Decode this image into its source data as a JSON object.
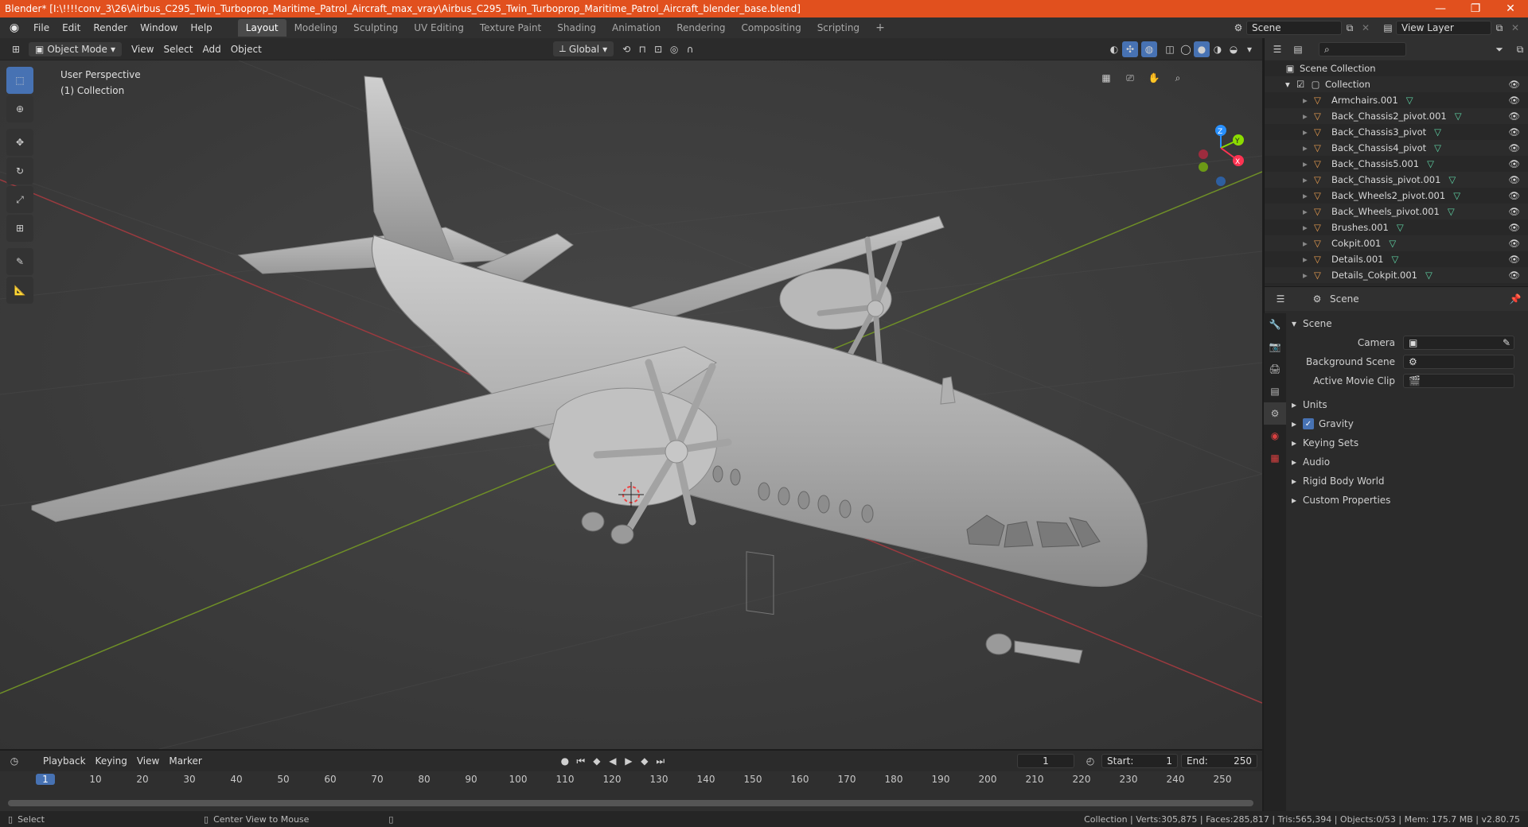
{
  "titlebar": {
    "title": "Blender* [I:\\!!!!conv_3\\26\\Airbus_C295_Twin_Turboprop_Maritime_Patrol_Aircraft_max_vray\\Airbus_C295_Twin_Turboprop_Maritime_Patrol_Aircraft_blender_base.blend]",
    "minimize": "—",
    "maximize": "❐",
    "close": "✕"
  },
  "menubar": {
    "menus": [
      "File",
      "Edit",
      "Render",
      "Window",
      "Help"
    ],
    "workspaces": [
      "Layout",
      "Modeling",
      "Sculpting",
      "UV Editing",
      "Texture Paint",
      "Shading",
      "Animation",
      "Rendering",
      "Compositing",
      "Scripting"
    ],
    "active_workspace": "Layout",
    "add_tab": "+",
    "scene": "Scene",
    "view_layer": "View Layer"
  },
  "viewport_header": {
    "mode": "Object Mode",
    "menus": [
      "View",
      "Select",
      "Add",
      "Object"
    ],
    "orientation": "Global"
  },
  "viewport": {
    "perspective": "User Perspective",
    "collection": "(1) Collection"
  },
  "gizmo": {
    "z": "Z",
    "y": "Y",
    "x": "X"
  },
  "outliner": {
    "root": "Scene Collection",
    "collection": "Collection",
    "items": [
      "Armchairs.001",
      "Back_Chassis2_pivot.001",
      "Back_Chassis3_pivot",
      "Back_Chassis4_pivot",
      "Back_Chassis5.001",
      "Back_Chassis_pivot.001",
      "Back_Wheels2_pivot.001",
      "Back_Wheels_pivot.001",
      "Brushes.001",
      "Cokpit.001",
      "Details.001",
      "Details_Cokpit.001"
    ]
  },
  "properties": {
    "context": "Scene",
    "panel_title": "Scene",
    "fields": [
      {
        "label": "Camera",
        "value": ""
      },
      {
        "label": "Background Scene",
        "value": ""
      },
      {
        "label": "Active Movie Clip",
        "value": ""
      }
    ],
    "sections": [
      "Units",
      "Gravity",
      "Keying Sets",
      "Audio",
      "Rigid Body World",
      "Custom Properties"
    ],
    "gravity_checked": true
  },
  "timeline": {
    "menus": [
      "Playback",
      "Keying",
      "View",
      "Marker"
    ],
    "current_frame": "1",
    "start_label": "Start:",
    "start": "1",
    "end_label": "End:",
    "end": "250",
    "ticks": [
      "1",
      "10",
      "20",
      "30",
      "40",
      "50",
      "60",
      "70",
      "80",
      "90",
      "100",
      "110",
      "120",
      "130",
      "140",
      "150",
      "160",
      "170",
      "180",
      "190",
      "200",
      "210",
      "220",
      "230",
      "240",
      "250"
    ]
  },
  "statusbar": {
    "select": "Select",
    "center": "Center View to Mouse",
    "stats": "Collection | Verts:305,875 | Faces:285,817 | Tris:565,394 | Objects:0/53 | Mem: 175.7 MB | v2.80.75"
  },
  "colors": {
    "accent": "#4772b3",
    "title": "#e1501e",
    "object": "#e69c4f",
    "mesh": "#5fd3a5",
    "x_axis": "#ff3352",
    "y_axis": "#8bdc00",
    "z_axis": "#2890ff"
  }
}
